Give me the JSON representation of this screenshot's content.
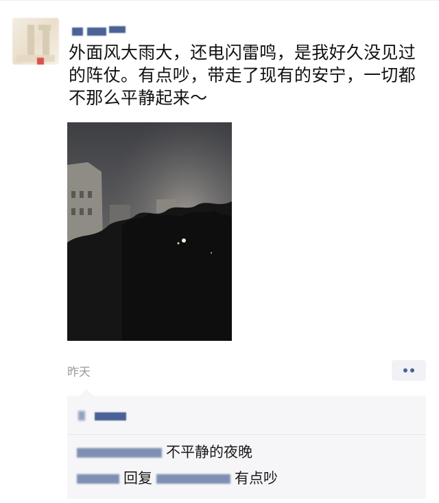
{
  "post": {
    "author": "",
    "text": "外面风大雨大，还电闪雷鸣，是我好久没见过的阵仗。有点吵，带走了现有的安宁，一切都不那么平静起来～",
    "timestamp": "昨天"
  },
  "comments": [
    {
      "text": "不平静的夜晚"
    },
    {
      "reply_word": "回复",
      "text": "有点吵"
    }
  ],
  "colors": {
    "link_blue": "#4b6296",
    "comment_bg": "#f6f6f8",
    "timestamp_gray": "#9a9a9a"
  }
}
